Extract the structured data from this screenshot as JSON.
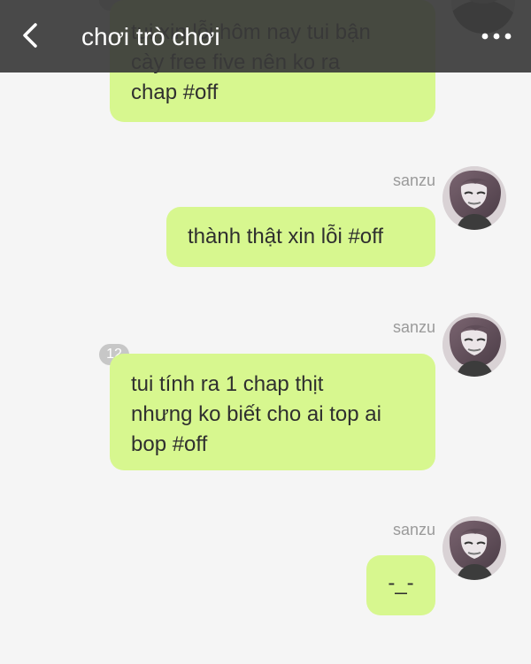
{
  "header": {
    "title": "chơi trò chơi",
    "back_icon": "chevron-left-icon",
    "more_icon": "more-horizontal-icon"
  },
  "messages": [
    {
      "sender": "",
      "text": "tui xin lỗi hôm nay tui bận\ncày free five nên ko ra\nchap #off",
      "badge": ""
    },
    {
      "sender": "sanzu",
      "text": "thành thật xin lỗi #off",
      "badge": ""
    },
    {
      "sender": "sanzu",
      "text": "tui tính ra 1 chap thịt\nnhưng ko biết cho ai top ai\nbop #off",
      "badge": "12"
    },
    {
      "sender": "sanzu",
      "text": "-_-",
      "badge": ""
    }
  ],
  "colors": {
    "bubble": "#d7f78f",
    "background": "#f5f5f5",
    "header": "#3a3a3a"
  }
}
